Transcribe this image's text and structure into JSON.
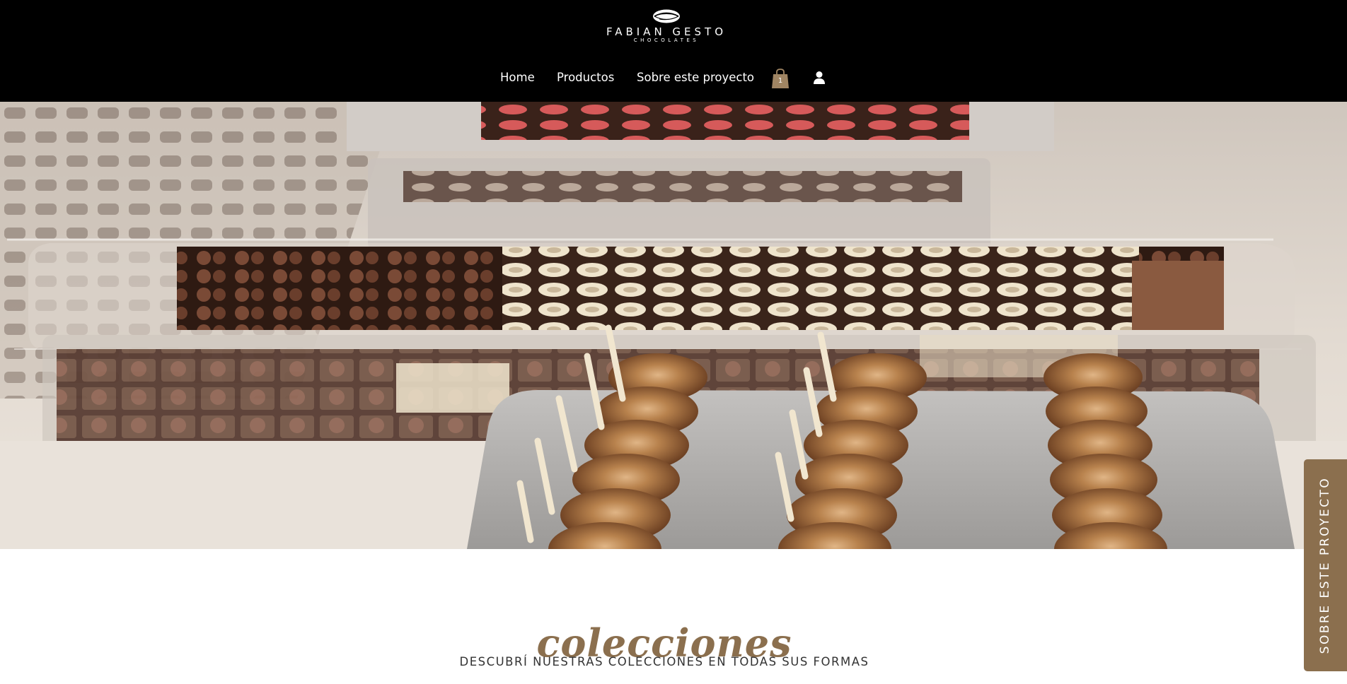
{
  "brand": {
    "name": "FABIAN GESTO",
    "sub": "CHOCOLATES",
    "colors": {
      "header_bg": "#000000",
      "accent": "#8b6f4e",
      "cart_bag": "#a08563"
    }
  },
  "nav": {
    "items": [
      {
        "label": "Home"
      },
      {
        "label": "Productos"
      },
      {
        "label": "Sobre este proyecto"
      }
    ],
    "cart": {
      "icon": "shopping-bag-icon",
      "count": "1"
    },
    "account": {
      "icon": "user-icon"
    }
  },
  "hero": {
    "image": "chocolate-bonbons-trays-photo"
  },
  "collections": {
    "title": "colecciones",
    "subtitle": "DESCUBRÍ NUESTRAS COLECCIONES EN TODAS SUS FORMAS"
  },
  "side_tab": {
    "label": "SOBRE ESTE PROYECTO"
  }
}
